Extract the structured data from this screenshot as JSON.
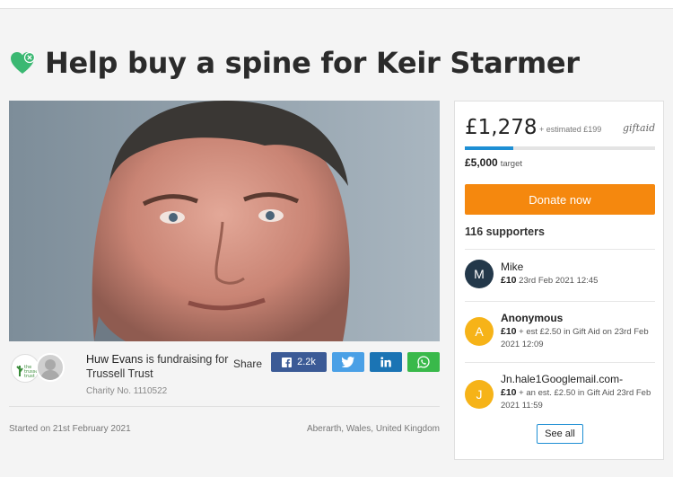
{
  "page": {
    "title": "Help buy a spine for Keir Starmer"
  },
  "fundraiser": {
    "name": "Huw Evans",
    "middle_text": " is fundraising for ",
    "charity": "Trussell Trust",
    "charity_no": "Charity No. 1110522",
    "started": "Started on 21st February 2021",
    "location": "Aberarth, Wales, United Kingdom",
    "org_logo_icon": "trussell-trust-logo",
    "avatar_icon": "default-user-avatar"
  },
  "share": {
    "label": "Share",
    "facebook_count": "2.2k",
    "facebook_icon": "facebook-icon",
    "twitter_icon": "twitter-icon",
    "linkedin_icon": "linkedin-icon",
    "whatsapp_icon": "whatsapp-icon",
    "colors": {
      "facebook": "#3b5a96",
      "twitter": "#4aa0e6",
      "linkedin": "#1b74b4",
      "whatsapp": "#39b94a"
    }
  },
  "donation_panel": {
    "raised": "£1,278",
    "estimate": "+ estimated £199",
    "giftaid": "giftaid",
    "target": "£5,000",
    "target_label": "target",
    "progress_fraction": 0.256,
    "donate_label": "Donate now",
    "supporters": "116 supporters",
    "see_all": "See all",
    "accent_color": "#f5880e",
    "progress_color": "#1e8fd4"
  },
  "donors": [
    {
      "initial": "M",
      "name": "Mike",
      "amount": "£10",
      "detail": " 23rd Feb 2021 12:45",
      "color": "#23384a"
    },
    {
      "initial": "A",
      "name": "Anonymous",
      "amount": "£10",
      "detail": " + est £2.50 in Gift Aid on 23rd Feb 2021 12:09",
      "color": "#f6b318"
    },
    {
      "initial": "J",
      "name": "Jn.hale1Googlemail.com-",
      "amount": "£10",
      "detail": " + an est. £2.50 in Gift Aid 23rd Feb 2021 11:59",
      "color": "#f6b318"
    }
  ]
}
